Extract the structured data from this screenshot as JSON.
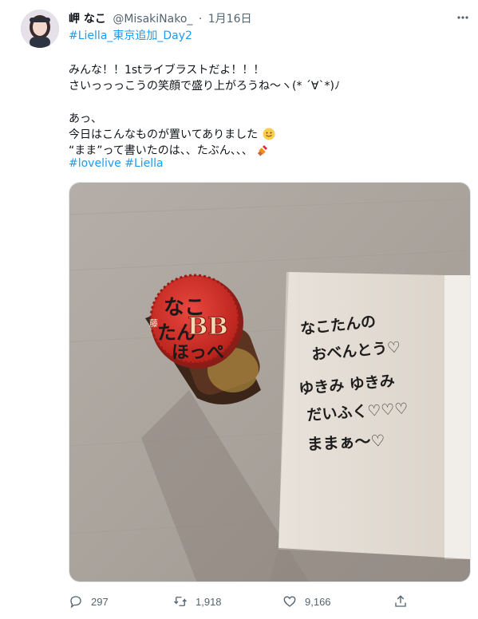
{
  "tweet": {
    "author_name": "岬 なこ",
    "handle": "@MisakiNako_",
    "separator": "·",
    "date": "1月16日",
    "hashtag_top": "#Liella_東京追加_Day2",
    "lines": [
      "みんな！！1stライブラストだよ！！！",
      "さいっっっこうの笑顔で盛り上がろうね〜ヽ(* ´∀`*)ﾉ",
      "",
      "あっ、",
      "今日はこんなものが置いてありました",
      "“まま”って書いたのは、、たぶん、、、"
    ],
    "hashtags_bottom": [
      "#lovelive",
      "#Liella"
    ],
    "emojis": [
      "slightly-smiling-face-icon",
      "lipstick-icon"
    ]
  },
  "photo": {
    "cap_text": [
      "なこ",
      "たん",
      "ほっぺ"
    ],
    "cap_badge": "BB",
    "cap_small": "藤",
    "note_lines": [
      "なこたんの",
      "おべんとう♡",
      "ゆきみ ゆきみ",
      "だいふく♡♡♡",
      "ままぁ〜♡"
    ]
  },
  "actions": {
    "reply_count": "297",
    "retweet_count": "1,918",
    "like_count": "9,166"
  },
  "colors": {
    "link": "#1d9bf0",
    "secondary": "#536471",
    "cap": "#d8332c"
  }
}
